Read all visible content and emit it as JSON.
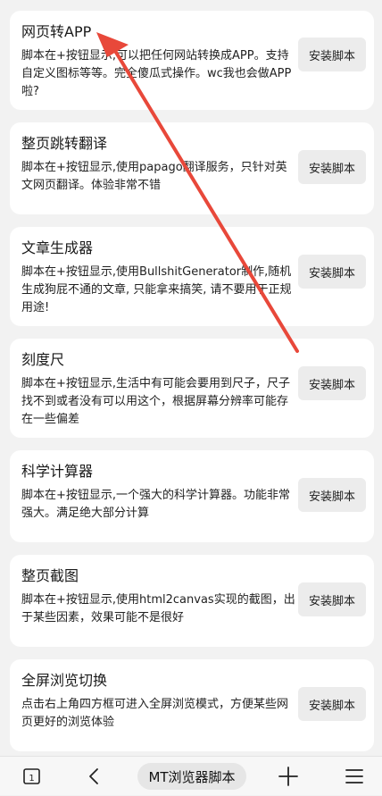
{
  "scripts": [
    {
      "title": "网页转APP",
      "desc": "脚本在+按钮显示,可以把任何网站转换成APP。支持自定义图标等等。完全傻瓜式操作。wc我也会做APP啦?",
      "button": "安装脚本"
    },
    {
      "title": "整页跳转翻译",
      "desc": "脚本在+按钮显示,使用papago翻译服务，只针对英文网页翻译。体验非常不错",
      "button": "安装脚本"
    },
    {
      "title": "文章生成器",
      "desc": "脚本在+按钮显示,使用BullshitGenerator制作,随机生成狗屁不通的文章, 只能拿来搞笑, 请不要用于正规用途!",
      "button": "安装脚本"
    },
    {
      "title": "刻度尺",
      "desc": "脚本在+按钮显示,生活中有可能会要用到尺子，尺子找不到或者没有可以用这个，根据屏幕分辨率可能存在一些偏差",
      "button": "安装脚本"
    },
    {
      "title": "科学计算器",
      "desc": "脚本在+按钮显示,一个强大的科学计算器。功能非常强大。满足绝大部分计算",
      "button": "安装脚本"
    },
    {
      "title": "整页截图",
      "desc": "脚本在+按钮显示,使用html2canvas实现的截图，出于某些因素，效果可能不是很好",
      "button": "安装脚本"
    },
    {
      "title": "全屏浏览切换",
      "desc": "点击右上角四方框可进入全屏浏览模式，方便某些网页更好的浏览体验",
      "button": "安装脚本"
    }
  ],
  "bottom_bar": {
    "tab_count": "1",
    "center_title": "MT浏览器脚本",
    "icons": [
      "tabs-icon",
      "back-icon",
      "plus-icon",
      "menu-icon"
    ]
  },
  "annotation": {
    "arrow_color": "#e8483a"
  }
}
